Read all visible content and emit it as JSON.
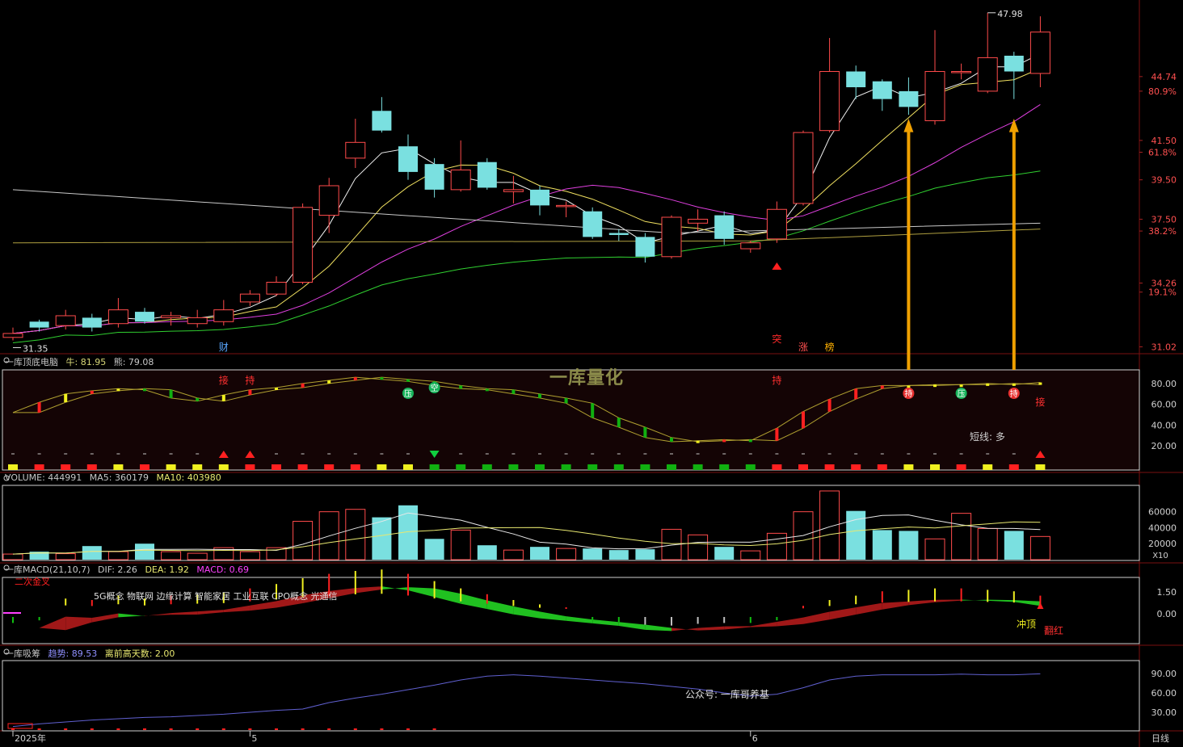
{
  "watermark": "一库量化",
  "panels": {
    "main": {
      "high_label": "47.98",
      "low_label": "31.35",
      "right_axis": [
        {
          "value": 44.74,
          "text": "44.74"
        },
        {
          "value": 44.0,
          "text": "80.9%"
        },
        {
          "value": 41.5,
          "text": "41.50"
        },
        {
          "value": 40.9,
          "text": "61.8%"
        },
        {
          "value": 39.5,
          "text": "39.50"
        },
        {
          "value": 37.5,
          "text": "37.50"
        },
        {
          "value": 36.9,
          "text": "38.2%"
        },
        {
          "value": 34.26,
          "text": "34.26"
        },
        {
          "value": 33.8,
          "text": "19.1%"
        },
        {
          "value": 31.02,
          "text": "31.02"
        }
      ],
      "signals": [
        {
          "i": 8,
          "text": "财",
          "color": "#5aa7ff"
        },
        {
          "i": 29,
          "text": "突",
          "color": "#ff2a2a"
        },
        {
          "i": 30,
          "text": "涨",
          "color": "#ff5050"
        },
        {
          "i": 31,
          "text": "榜",
          "color": "#ffb000"
        }
      ]
    },
    "top_bottom": {
      "title": "一库顶底电脑",
      "bull_label": "牛: 81.95",
      "bear_label": "熊: 79.08",
      "axis": [
        "80.00",
        "60.00",
        "40.00",
        "20.00"
      ],
      "short_term": "短线: 多",
      "labels": [
        {
          "i": 8,
          "text": "接",
          "color": "#ff3030",
          "pos": "top"
        },
        {
          "i": 9,
          "text": "持",
          "color": "#ff3030",
          "pos": "top"
        },
        {
          "i": 29,
          "text": "持",
          "color": "#ff3030",
          "pos": "top"
        },
        {
          "i": 39,
          "text": "接",
          "color": "#ff3030",
          "pos": "below"
        }
      ],
      "badges": [
        {
          "i": 15,
          "text": "压",
          "color": "#16b35a"
        },
        {
          "i": 16,
          "text": "空",
          "color": "#16b35a"
        },
        {
          "i": 34,
          "text": "持",
          "color": "#e83030"
        },
        {
          "i": 36,
          "text": "压",
          "color": "#16b35a"
        },
        {
          "i": 38,
          "text": "持",
          "color": "#e83030"
        }
      ]
    },
    "volume": {
      "title": "VOLUME: 444991",
      "ma5": "MA5: 360179",
      "ma10": "MA10: 403980",
      "axis": [
        "60000",
        "40000",
        "20000"
      ],
      "unit": "X10"
    },
    "macd": {
      "title": "一库MACD(21,10,7)",
      "dif": "DIF: 2.26",
      "dea": "DEA: 1.92",
      "macd": "MACD: 0.69",
      "axis": [
        "1.50",
        "0.00"
      ],
      "label_left": "二次金叉",
      "concept_text": "5G概念 物联网 边缘计算 智能家居 工业互联 CPO概念 光通信",
      "label_chongding": "冲顶",
      "label_fanhong": "翻红"
    },
    "accumulate": {
      "title": "一库吸筹",
      "trend": "趋势: 89.53",
      "days": "离前高天数: 2.00",
      "axis": [
        "90.00",
        "60.00",
        "30.00"
      ],
      "promo": "公众号: 一库哥养基"
    }
  },
  "x_axis": {
    "labels": [
      {
        "i": 0,
        "text": "2025年"
      },
      {
        "i": 9,
        "text": "5"
      },
      {
        "i": 28,
        "text": "6"
      }
    ],
    "period": "日线"
  },
  "chart_data": {
    "type": "candlestick",
    "candles": [
      {
        "o": 31.5,
        "c": 31.7,
        "h": 32.0,
        "l": 31.35
      },
      {
        "o": 32.3,
        "c": 32.0,
        "h": 32.4,
        "l": 31.8
      },
      {
        "o": 32.1,
        "c": 32.6,
        "h": 32.9,
        "l": 31.9
      },
      {
        "o": 32.5,
        "c": 32.0,
        "h": 32.7,
        "l": 31.8
      },
      {
        "o": 32.2,
        "c": 32.9,
        "h": 33.5,
        "l": 32.0
      },
      {
        "o": 32.8,
        "c": 32.3,
        "h": 33.0,
        "l": 32.2
      },
      {
        "o": 32.5,
        "c": 32.6,
        "h": 32.8,
        "l": 32.1
      },
      {
        "o": 32.2,
        "c": 32.5,
        "h": 32.9,
        "l": 32.0
      },
      {
        "o": 32.3,
        "c": 32.9,
        "h": 33.4,
        "l": 32.1
      },
      {
        "o": 33.3,
        "c": 33.7,
        "h": 33.9,
        "l": 33.1
      },
      {
        "o": 33.7,
        "c": 34.3,
        "h": 34.6,
        "l": 33.6
      },
      {
        "o": 34.3,
        "c": 38.1,
        "h": 38.3,
        "l": 34.2
      },
      {
        "o": 37.7,
        "c": 39.2,
        "h": 39.6,
        "l": 36.8
      },
      {
        "o": 40.6,
        "c": 41.4,
        "h": 42.6,
        "l": 40.1
      },
      {
        "o": 43.0,
        "c": 42.0,
        "h": 43.7,
        "l": 41.9
      },
      {
        "o": 41.2,
        "c": 39.9,
        "h": 41.8,
        "l": 39.5
      },
      {
        "o": 40.3,
        "c": 39.0,
        "h": 40.6,
        "l": 38.6
      },
      {
        "o": 39.0,
        "c": 40.0,
        "h": 41.5,
        "l": 38.9
      },
      {
        "o": 40.4,
        "c": 39.1,
        "h": 40.6,
        "l": 39.0
      },
      {
        "o": 38.9,
        "c": 39.0,
        "h": 39.7,
        "l": 38.3
      },
      {
        "o": 39.0,
        "c": 38.2,
        "h": 39.2,
        "l": 37.7
      },
      {
        "o": 38.2,
        "c": 38.2,
        "h": 38.4,
        "l": 37.6
      },
      {
        "o": 37.9,
        "c": 36.6,
        "h": 38.1,
        "l": 36.5
      },
      {
        "o": 36.8,
        "c": 36.7,
        "h": 37.0,
        "l": 36.4
      },
      {
        "o": 36.6,
        "c": 35.6,
        "h": 36.8,
        "l": 35.3
      },
      {
        "o": 35.6,
        "c": 37.6,
        "h": 37.7,
        "l": 35.5
      },
      {
        "o": 37.3,
        "c": 37.5,
        "h": 38.0,
        "l": 36.9
      },
      {
        "o": 37.7,
        "c": 36.5,
        "h": 37.9,
        "l": 36.2
      },
      {
        "o": 36.0,
        "c": 36.3,
        "h": 36.4,
        "l": 35.8
      },
      {
        "o": 36.5,
        "c": 38.0,
        "h": 38.4,
        "l": 36.3
      },
      {
        "o": 38.3,
        "c": 41.9,
        "h": 42.0,
        "l": 38.2
      },
      {
        "o": 42.0,
        "c": 45.0,
        "h": 46.7,
        "l": 41.9
      },
      {
        "o": 45.0,
        "c": 44.2,
        "h": 45.3,
        "l": 43.6
      },
      {
        "o": 44.5,
        "c": 43.6,
        "h": 44.6,
        "l": 43.0
      },
      {
        "o": 44.0,
        "c": 43.2,
        "h": 44.7,
        "l": 42.8
      },
      {
        "o": 42.5,
        "c": 45.0,
        "h": 47.1,
        "l": 42.3
      },
      {
        "o": 45.0,
        "c": 45.0,
        "h": 45.4,
        "l": 44.6
      },
      {
        "o": 44.0,
        "c": 45.7,
        "h": 47.98,
        "l": 43.9
      },
      {
        "o": 45.8,
        "c": 45.0,
        "h": 46.0,
        "l": 43.6
      },
      {
        "o": 44.9,
        "c": 47.0,
        "h": 47.8,
        "l": 44.2
      }
    ],
    "volume": [
      7000,
      10000,
      7500,
      17000,
      10000,
      20000,
      10000,
      8000,
      15000,
      10000,
      15000,
      48000,
      60000,
      63000,
      53000,
      68000,
      26000,
      37000,
      18000,
      12000,
      16000,
      14000,
      14000,
      12000,
      13000,
      38000,
      31000,
      16000,
      11000,
      33000,
      60000,
      86000,
      61000,
      37000,
      36000,
      26000,
      58000,
      39000,
      36000,
      29000,
      53000
    ],
    "macd_bars": [
      -0.5,
      -0.2,
      0.6,
      0.5,
      0.8,
      0.6,
      0.8,
      0.9,
      1.0,
      1.3,
      1.6,
      2.0,
      2.3,
      2.5,
      2.6,
      2.3,
      1.8,
      1.3,
      0.9,
      0.5,
      0.2,
      0.0,
      -0.2,
      -0.4,
      -0.7,
      -0.8,
      -0.6,
      -0.5,
      -0.5,
      -0.2,
      0.1,
      0.5,
      0.8,
      1.1,
      1.2,
      1.3,
      1.3,
      1.2,
      1.1,
      0.8,
      0.9
    ],
    "top_bottom": [
      52,
      62,
      70,
      73,
      75,
      74,
      66,
      63,
      69,
      74,
      76,
      80,
      83,
      86,
      84,
      82,
      78,
      75,
      74,
      70,
      66,
      61,
      47,
      38,
      28,
      24,
      25,
      26,
      25,
      37,
      53,
      65,
      75,
      78,
      78,
      79,
      79,
      80,
      79,
      81
    ]
  }
}
